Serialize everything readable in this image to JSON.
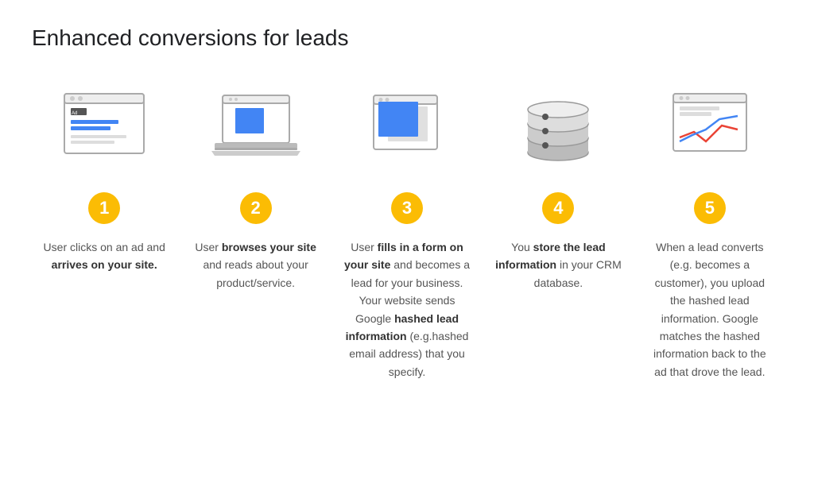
{
  "title": "Enhanced conversions for leads",
  "steps": [
    {
      "number": "1",
      "icon": "ad",
      "text_html": "User clicks on an ad and <b>arrives on your site.</b>"
    },
    {
      "number": "2",
      "icon": "laptop",
      "text_html": "User <b>browses your site</b> and reads about your product/service."
    },
    {
      "number": "3",
      "icon": "form",
      "text_html": "User <b>fills in a form on your site</b> and becomes a lead for your business. Your website sends Google <b>hashed lead information</b> (e.g.hashed email address) that you specify."
    },
    {
      "number": "4",
      "icon": "database",
      "text_html": "You <b>store the lead information</b> in your CRM database."
    },
    {
      "number": "5",
      "icon": "chart",
      "text_html": "When a lead converts (e.g. becomes a customer), you upload the hashed lead information. Google matches the hashed information back to the ad that drove the lead."
    }
  ]
}
